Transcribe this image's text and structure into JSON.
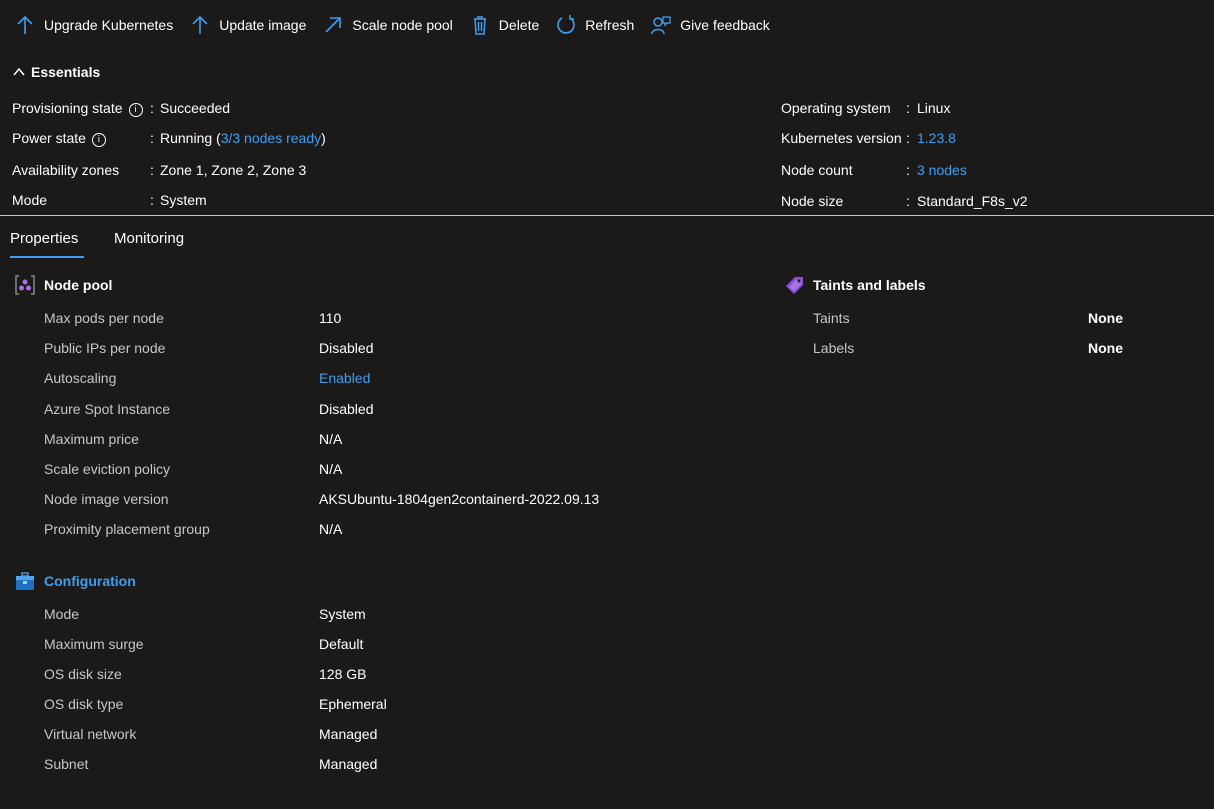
{
  "toolbar": {
    "upgrade": "Upgrade Kubernetes",
    "update_image": "Update image",
    "scale": "Scale node pool",
    "delete": "Delete",
    "refresh": "Refresh",
    "feedback": "Give feedback"
  },
  "essentials": {
    "title": "Essentials",
    "provisioning_label": "Provisioning state",
    "provisioning_value": "Succeeded",
    "power_label": "Power state",
    "power_value_prefix": "Running (",
    "power_value_link": "3/3 nodes ready",
    "power_value_suffix": ")",
    "zones_label": "Availability zones",
    "zones_value": "Zone 1, Zone 2, Zone 3",
    "mode_label": "Mode",
    "mode_value": "System",
    "os_label": "Operating system",
    "os_value": "Linux",
    "k8s_label": "Kubernetes version",
    "k8s_value": "1.23.8",
    "count_label": "Node count",
    "count_value": "3 nodes",
    "size_label": "Node size",
    "size_value": "Standard_F8s_v2",
    "separator": ":"
  },
  "tabs": {
    "properties": "Properties",
    "monitoring": "Monitoring"
  },
  "node_pool": {
    "title": "Node pool",
    "rows": [
      {
        "label": "Max pods per node",
        "value": "110"
      },
      {
        "label": "Public IPs per node",
        "value": "Disabled"
      },
      {
        "label": "Autoscaling",
        "value": "Enabled"
      },
      {
        "label": "Azure Spot Instance",
        "value": "Disabled"
      },
      {
        "label": "Maximum price",
        "value": "N/A"
      },
      {
        "label": "Scale eviction policy",
        "value": "N/A"
      },
      {
        "label": "Node image version",
        "value": "AKSUbuntu-1804gen2containerd-2022.09.13"
      },
      {
        "label": "Proximity placement group",
        "value": "N/A"
      }
    ]
  },
  "taints": {
    "title": "Taints and labels",
    "rows": [
      {
        "label": "Taints",
        "value": "None"
      },
      {
        "label": "Labels",
        "value": "None"
      }
    ]
  },
  "configuration": {
    "title": "Configuration",
    "rows": [
      {
        "label": "Mode",
        "value": "System"
      },
      {
        "label": "Maximum surge",
        "value": "Default"
      },
      {
        "label": "OS disk size",
        "value": "128 GB"
      },
      {
        "label": "OS disk type",
        "value": "Ephemeral"
      },
      {
        "label": "Virtual network",
        "value": "Managed"
      },
      {
        "label": "Subnet",
        "value": "Managed"
      }
    ]
  },
  "colors": {
    "accent": "#3aa0f3",
    "background": "#1b1a19",
    "label": "#c8c6c4"
  }
}
